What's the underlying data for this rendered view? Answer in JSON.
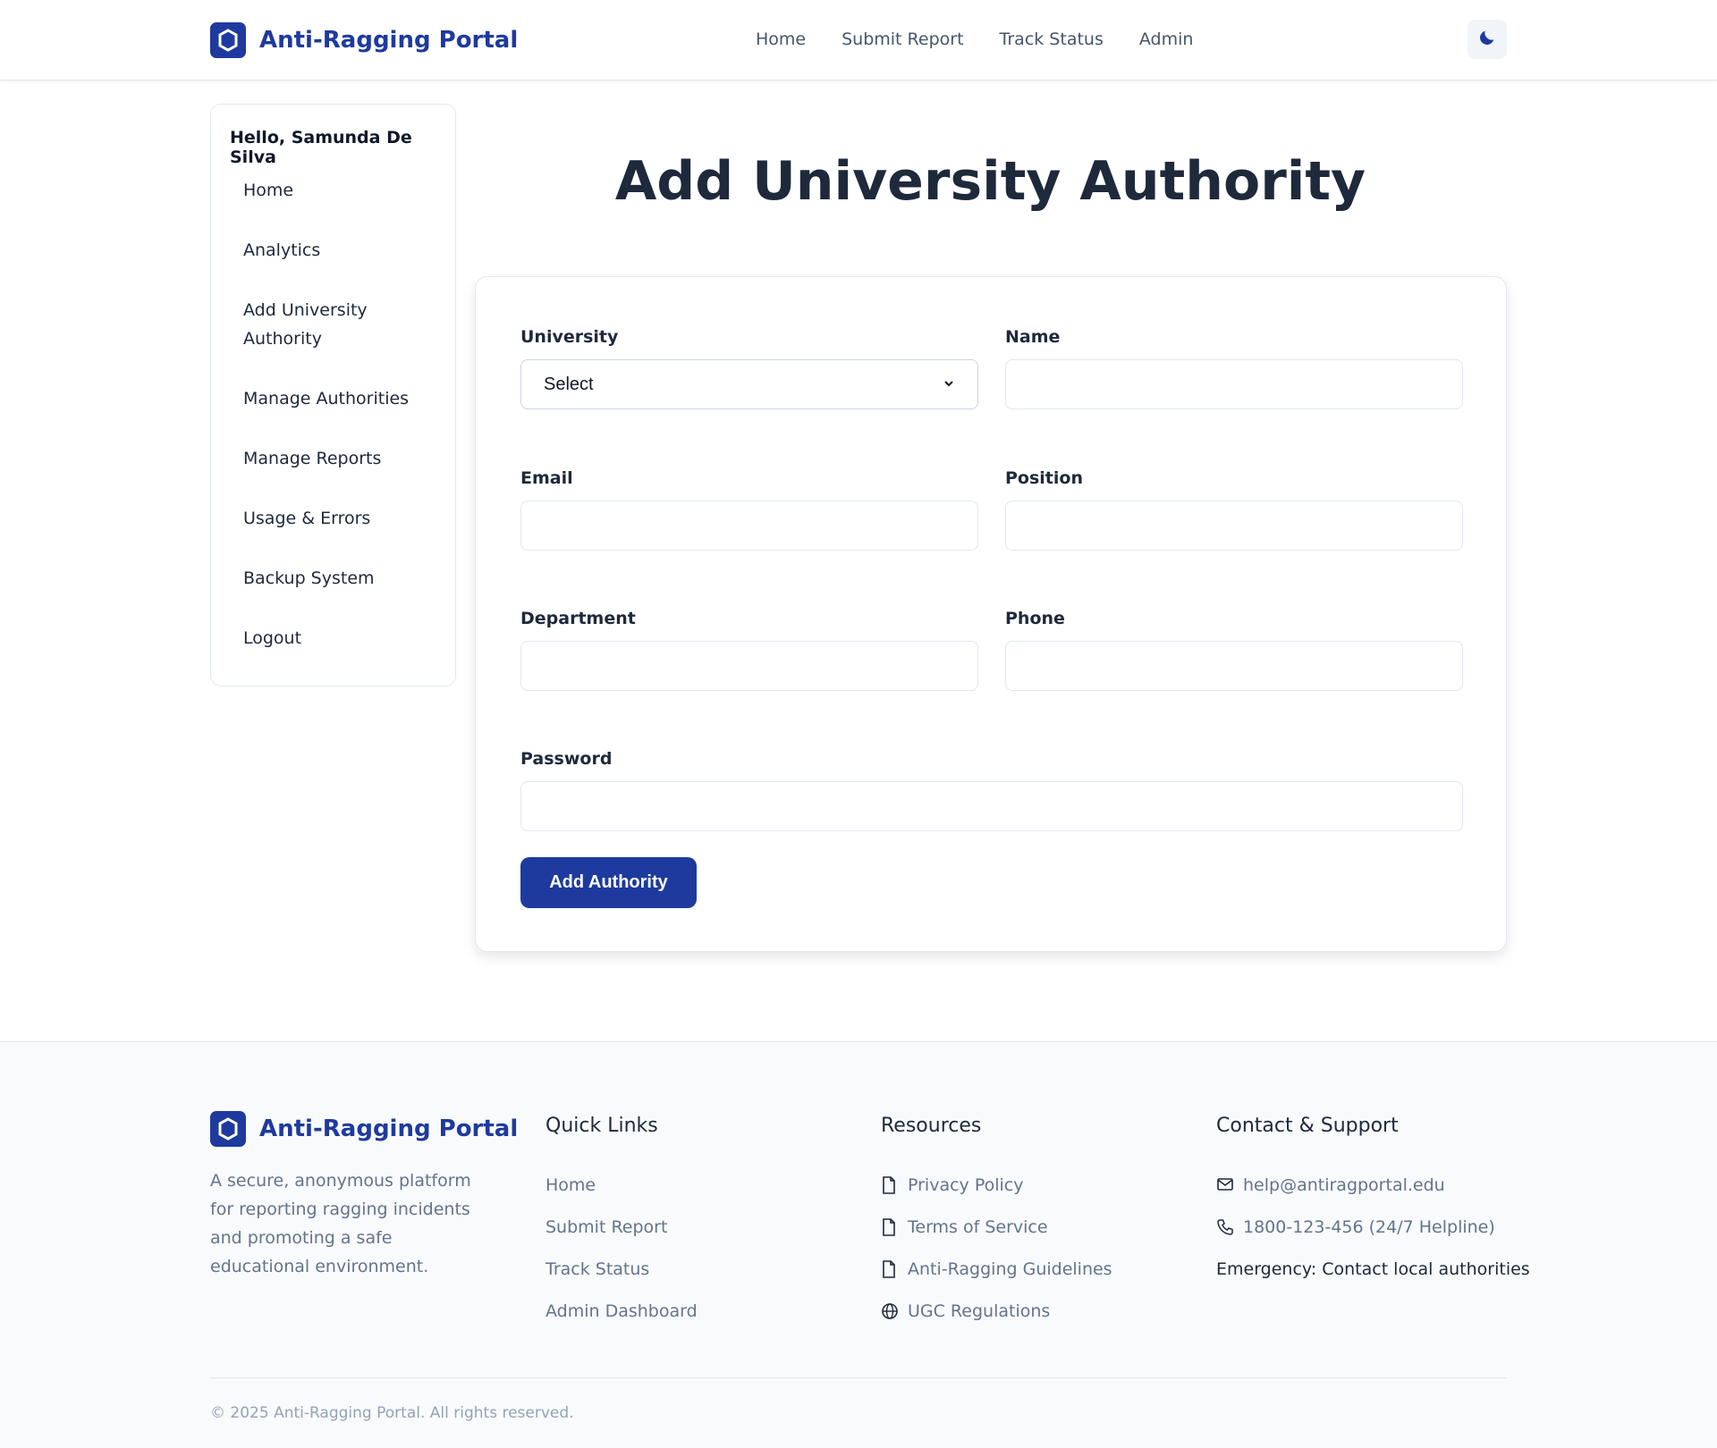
{
  "header": {
    "brand": "Anti-Ragging Portal",
    "nav": [
      "Home",
      "Submit Report",
      "Track Status",
      "Admin"
    ]
  },
  "sidebar": {
    "greeting": "Hello, Samunda De Silva",
    "items": [
      "Home",
      "Analytics",
      "Add University Authority",
      "Manage Authorities",
      "Manage Reports",
      "Usage & Errors",
      "Backup System",
      "Logout"
    ]
  },
  "main": {
    "title": "Add University Authority",
    "form": {
      "university_label": "University",
      "university_value": "Select",
      "name_label": "Name",
      "email_label": "Email",
      "position_label": "Position",
      "department_label": "Department",
      "phone_label": "Phone",
      "password_label": "Password",
      "submit_label": "Add Authority"
    }
  },
  "footer": {
    "brand": "Anti-Ragging Portal",
    "description": "A secure, anonymous platform for reporting ragging incidents and promoting a safe educational environment.",
    "quick_links": {
      "title": "Quick Links",
      "items": [
        "Home",
        "Submit Report",
        "Track Status",
        "Admin Dashboard"
      ]
    },
    "resources": {
      "title": "Resources",
      "items": [
        "Privacy Policy",
        "Terms of Service",
        "Anti-Ragging Guidelines",
        "UGC Regulations"
      ]
    },
    "contact": {
      "title": "Contact & Support",
      "email": "help@antiragportal.edu",
      "phone": "1800-123-456 (24/7 Helpline)",
      "emergency": "Emergency: Contact local authorities"
    },
    "copyright": "© 2025 Anti-Ragging Portal. All rights reserved."
  },
  "colors": {
    "primary": "#1e3a9e",
    "text": "#1e293b",
    "muted": "#64748b",
    "border": "#e2e8f0"
  },
  "icons": [
    "shield-icon",
    "moon-icon",
    "chevron-down-icon",
    "document-icon",
    "globe-icon",
    "mail-icon",
    "phone-icon"
  ]
}
